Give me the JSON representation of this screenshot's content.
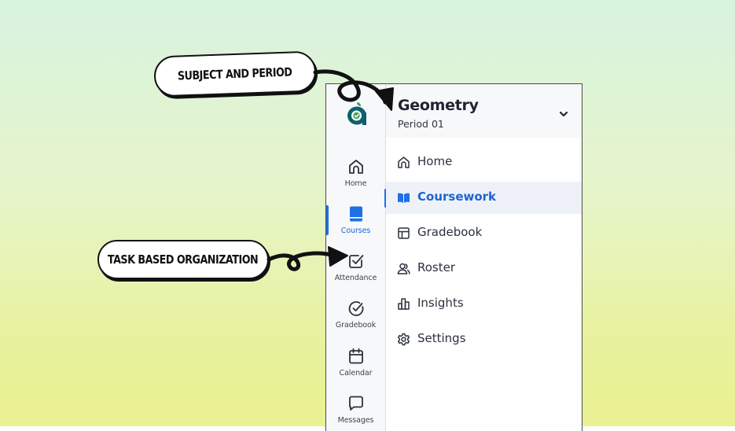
{
  "callouts": {
    "subject": "SUBJECT AND PERIOD",
    "task": "TASK BASED ORGANIZATION"
  },
  "header": {
    "title": "Geometry",
    "subtitle": "Period 01"
  },
  "rail": {
    "items": [
      {
        "label": "Home",
        "icon": "home-icon"
      },
      {
        "label": "Courses",
        "icon": "book-icon",
        "active": true
      },
      {
        "label": "Attendance",
        "icon": "checkbox-icon"
      },
      {
        "label": "Gradebook",
        "icon": "check-circle-icon"
      },
      {
        "label": "Calendar",
        "icon": "calendar-icon"
      },
      {
        "label": "Messages",
        "icon": "message-icon"
      }
    ]
  },
  "menu": {
    "items": [
      {
        "label": "Home",
        "icon": "home-icon"
      },
      {
        "label": "Coursework",
        "icon": "open-book-icon",
        "active": true
      },
      {
        "label": "Gradebook",
        "icon": "table-icon"
      },
      {
        "label": "Roster",
        "icon": "people-icon"
      },
      {
        "label": "Insights",
        "icon": "bar-chart-icon"
      },
      {
        "label": "Settings",
        "icon": "gear-icon"
      }
    ]
  },
  "colors": {
    "accent": "#1f6fe5",
    "logo_teal": "#0e5f6b",
    "logo_green": "#3aa35a"
  }
}
